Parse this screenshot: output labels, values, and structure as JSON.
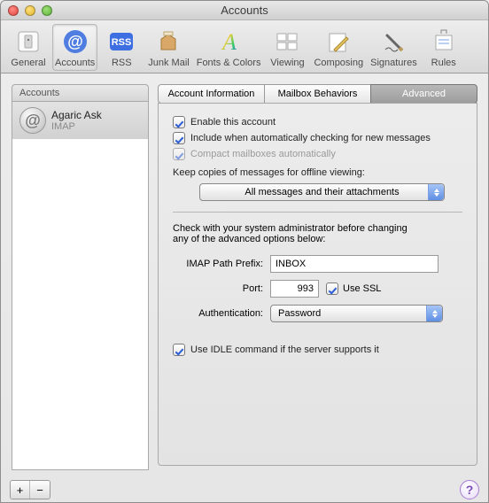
{
  "window": {
    "title": "Accounts"
  },
  "toolbar": {
    "items": [
      {
        "label": "General"
      },
      {
        "label": "Accounts"
      },
      {
        "label": "RSS"
      },
      {
        "label": "Junk Mail"
      },
      {
        "label": "Fonts & Colors"
      },
      {
        "label": "Viewing"
      },
      {
        "label": "Composing"
      },
      {
        "label": "Signatures"
      },
      {
        "label": "Rules"
      }
    ],
    "selected_index": 1
  },
  "sidebar": {
    "header": "Accounts",
    "items": [
      {
        "name": "Agaric Ask",
        "type": "IMAP"
      }
    ],
    "selected_index": 0
  },
  "tabs": {
    "items": [
      "Account Information",
      "Mailbox Behaviors",
      "Advanced"
    ],
    "selected_index": 2
  },
  "advanced": {
    "enable_label": "Enable this account",
    "enable_checked": true,
    "include_label": "Include when automatically checking for new messages",
    "include_checked": true,
    "compact_label": "Compact mailboxes automatically",
    "compact_checked": true,
    "compact_disabled": true,
    "offline_label": "Keep copies of messages for offline viewing:",
    "offline_select": "All messages and their attachments",
    "admin_note1": "Check with your system administrator before changing",
    "admin_note2": "any of the advanced options below:",
    "imap_prefix_label": "IMAP Path Prefix:",
    "imap_prefix_value": "INBOX",
    "port_label": "Port:",
    "port_value": "993",
    "ssl_label": "Use SSL",
    "ssl_checked": true,
    "auth_label": "Authentication:",
    "auth_value": "Password",
    "idle_label": "Use IDLE command if the server supports it",
    "idle_checked": true
  },
  "buttons": {
    "add": "+",
    "remove": "−",
    "help": "?"
  }
}
